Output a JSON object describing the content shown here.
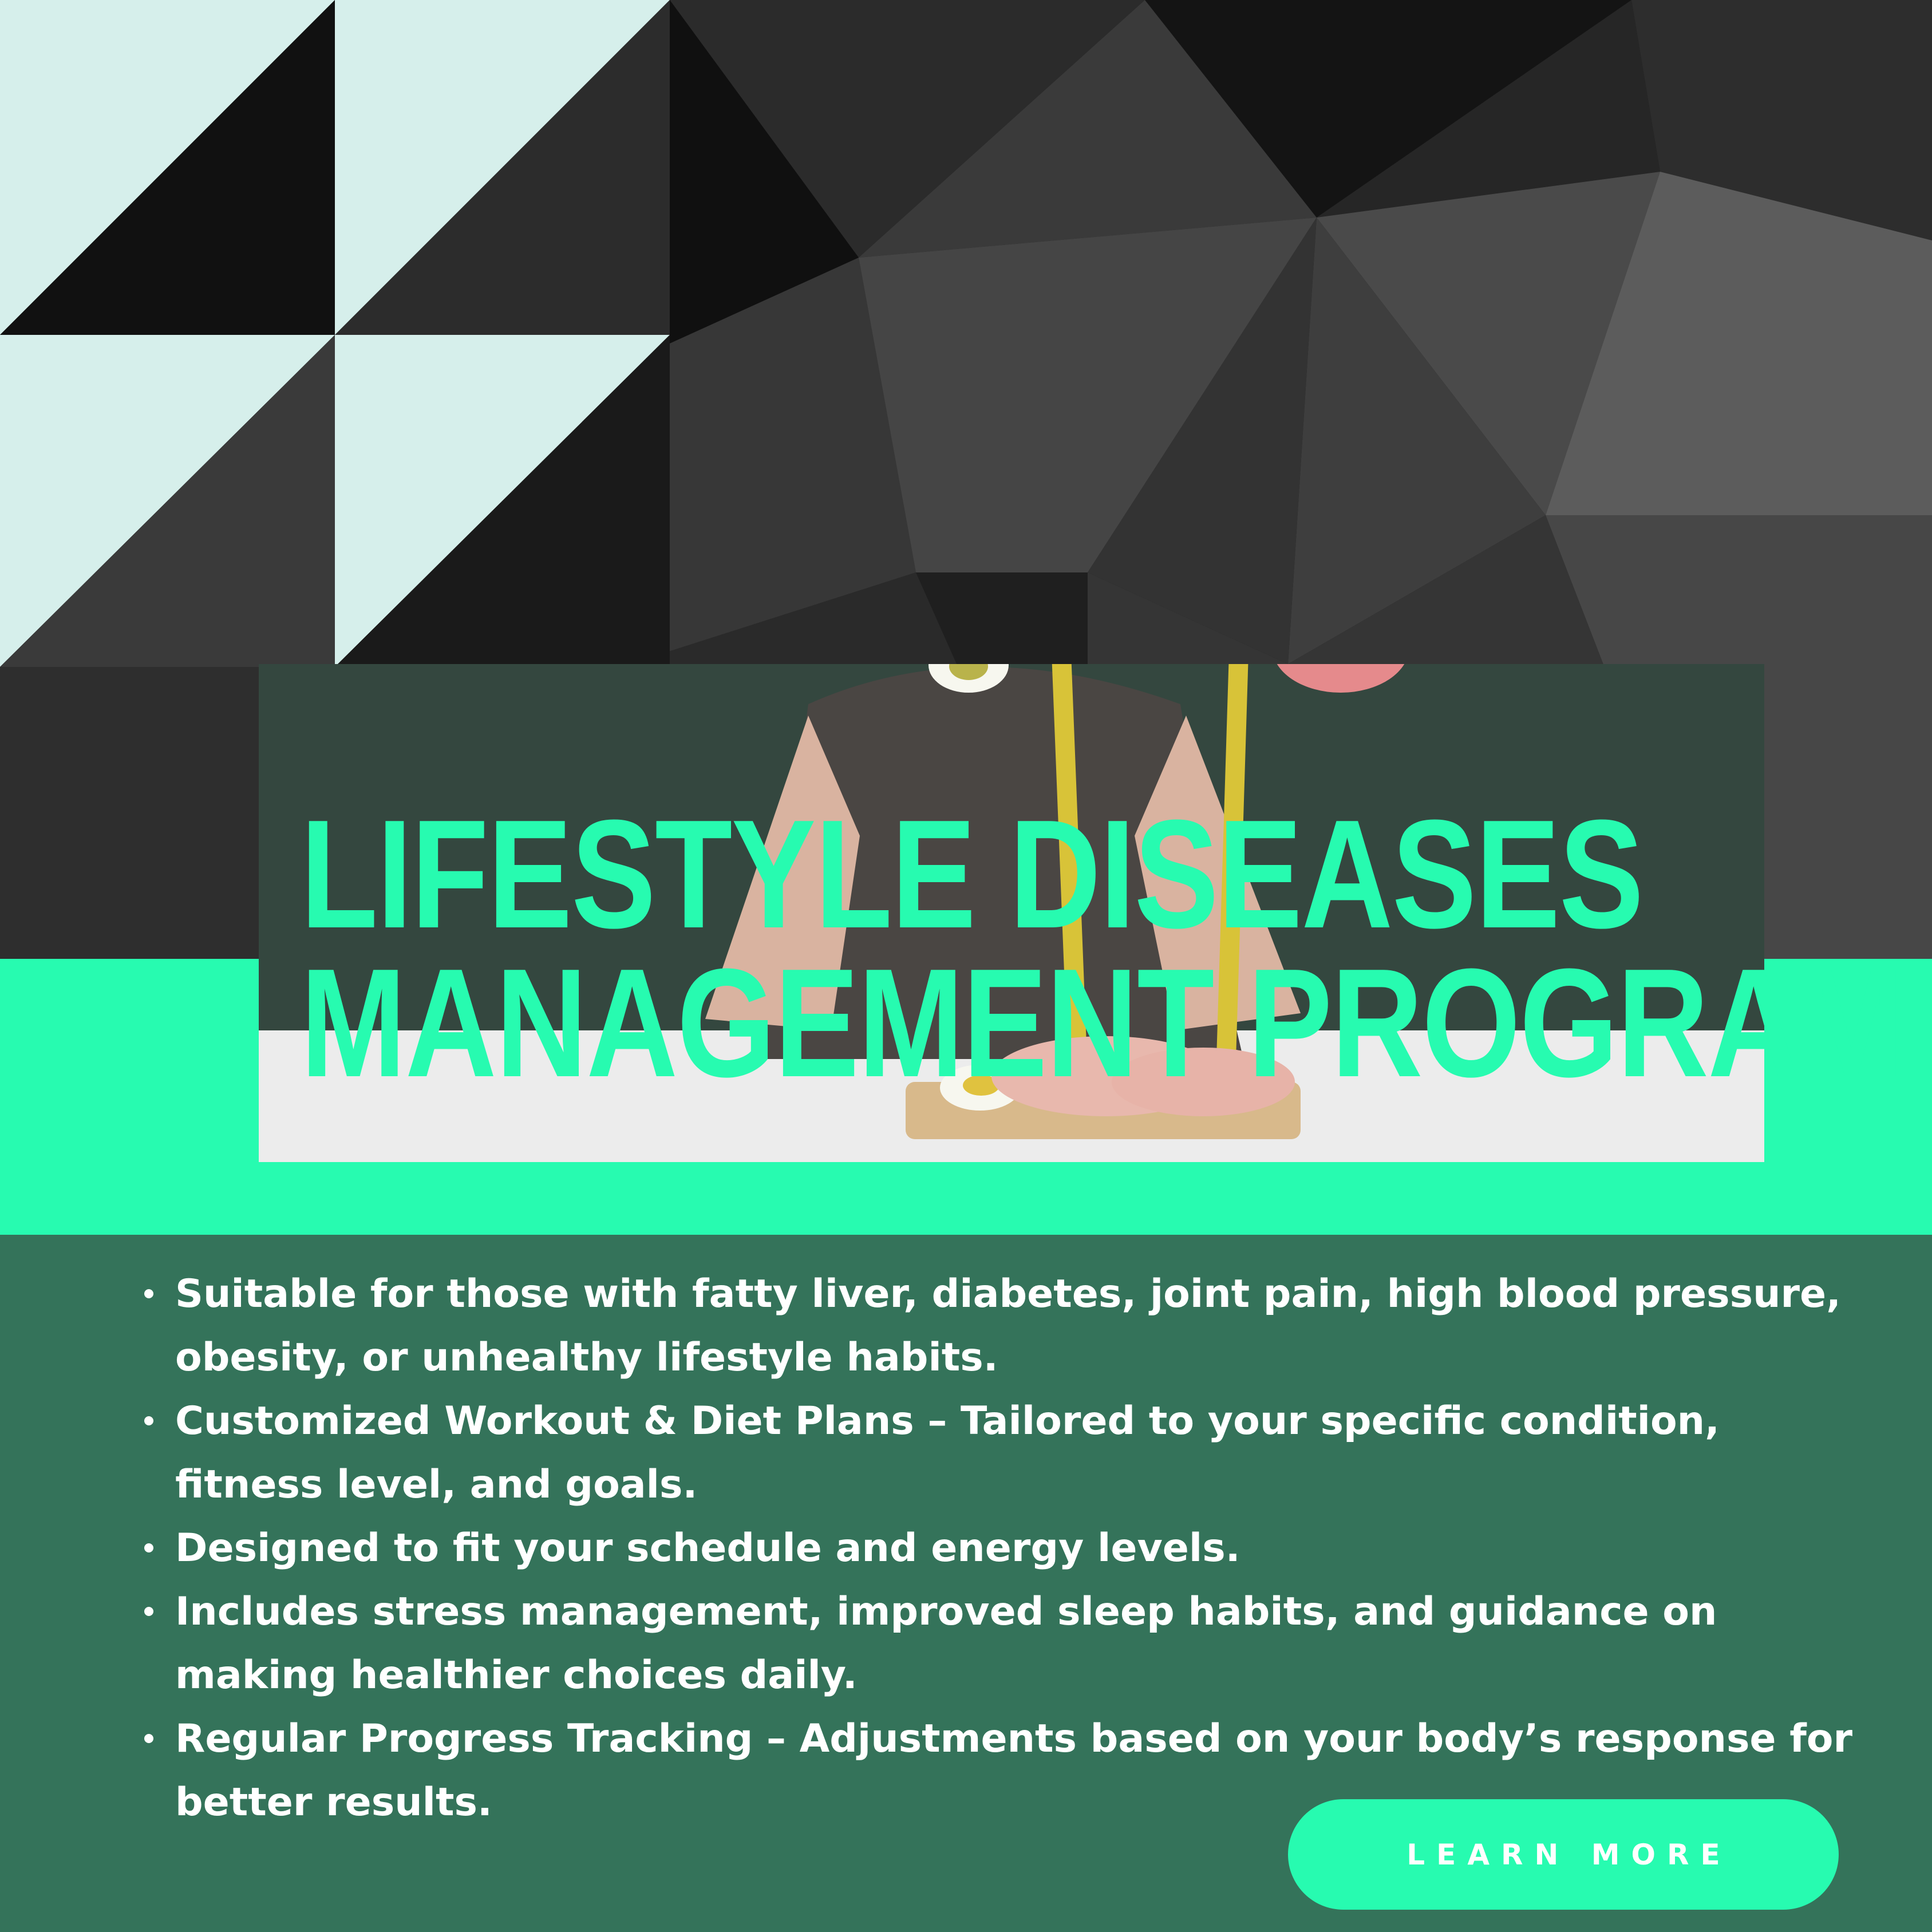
{
  "headline": {
    "line1": "LIFESTYLE DISEASES",
    "line2": "MANAGEMENT PROGRAM"
  },
  "benefits": [
    "Suitable for those with fatty liver, diabetes, joint pain, high blood pressure, obesity, or unhealthy lifestyle habits.",
    "Customized Workout & Diet Plans – Tailored to your specific condition, fitness level, and goals.",
    "Designed to fit your schedule and energy levels.",
    " Includes stress management, improved sleep habits, and guidance on making healthier choices daily.",
    "Regular Progress Tracking – Adjustments based on your body’s response for better results."
  ],
  "cta": {
    "label": "LEARN MORE"
  },
  "colors": {
    "accent_mint": "#27fbb0",
    "panel_green": "#34735a",
    "pale_mint": "#d6efeb",
    "dark_background": "#1e1e1e"
  }
}
